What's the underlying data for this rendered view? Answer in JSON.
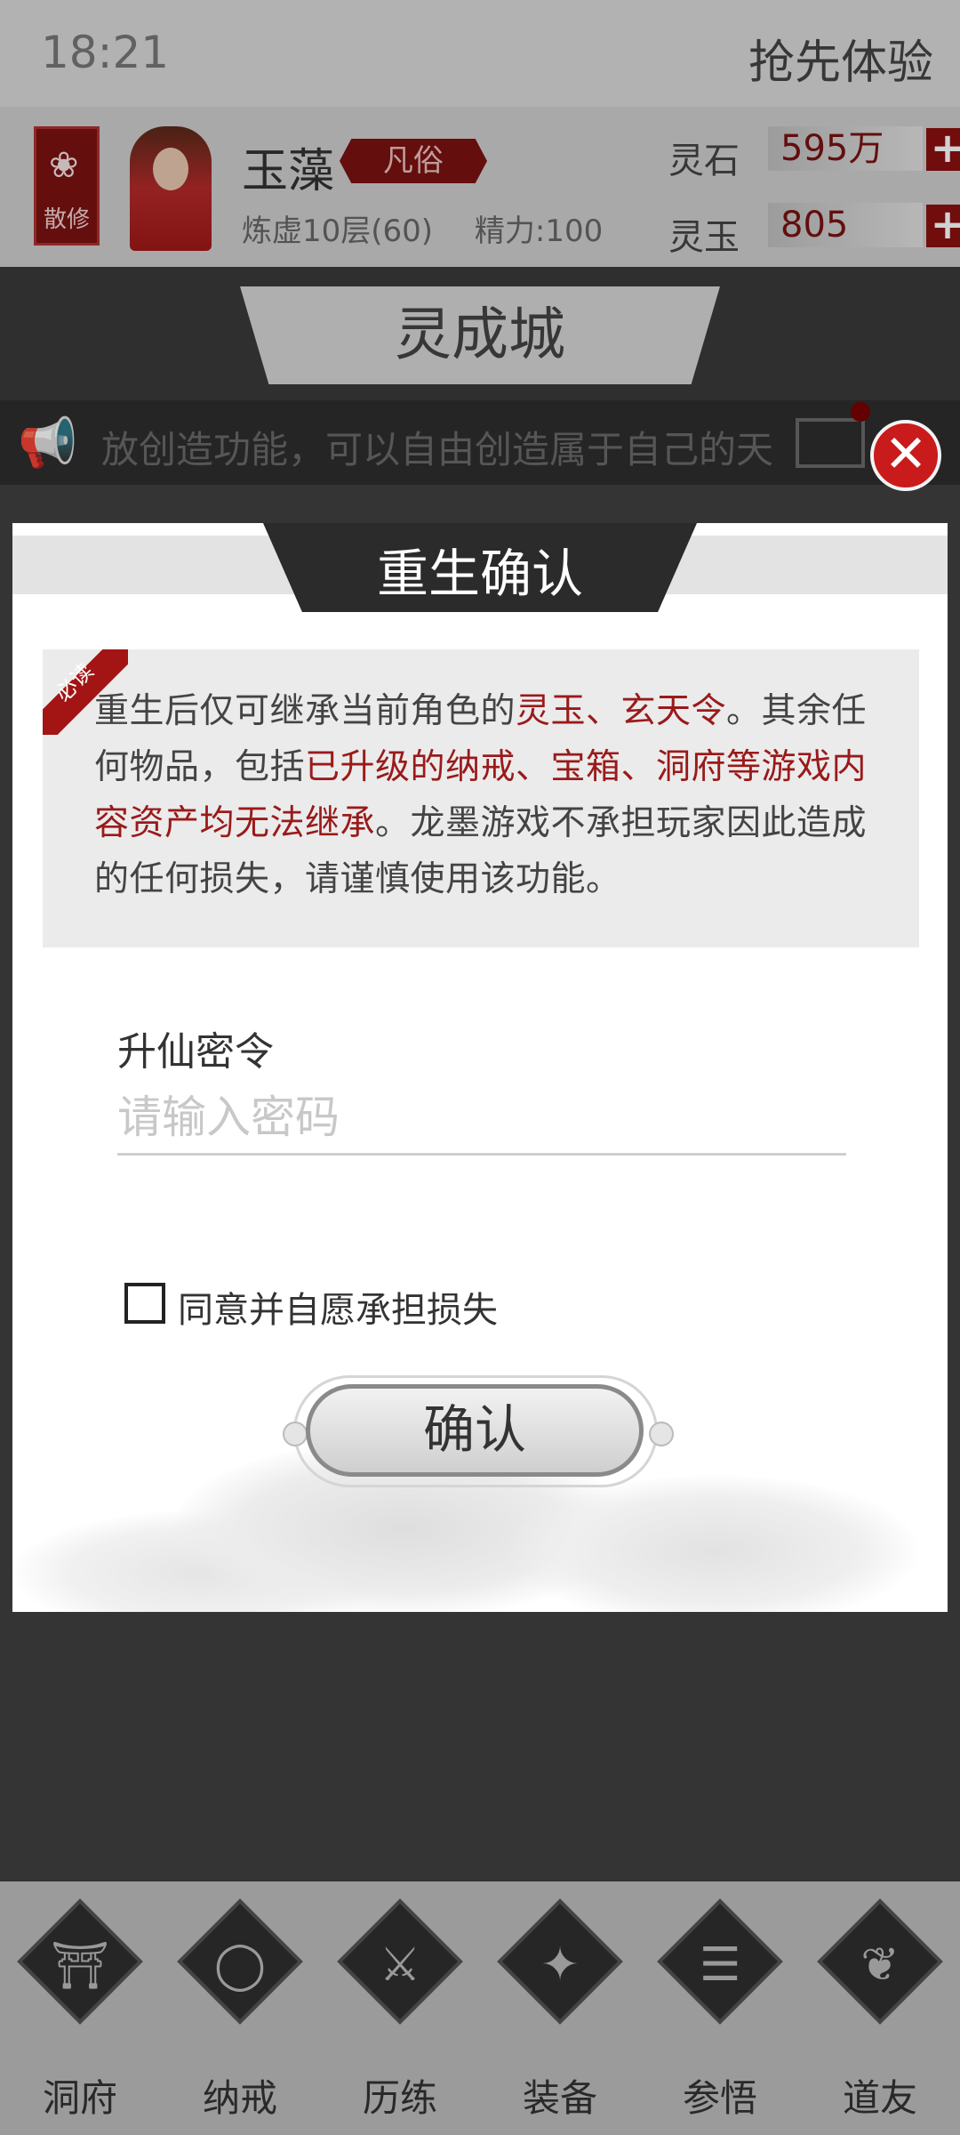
{
  "status_bar": {
    "time": "18:21",
    "early_access": "抢先体验"
  },
  "player": {
    "sect_label": "散修",
    "name": "玉藻",
    "rank": "凡俗",
    "realm": "炼虚10层(60)",
    "energy": "精力:100",
    "currencies": [
      {
        "label": "灵石",
        "value": "595万"
      },
      {
        "label": "灵玉",
        "value": "805"
      }
    ]
  },
  "city": {
    "name": "灵成城"
  },
  "ticker": {
    "text": "放创造功能，可以自由创造属于自己的天"
  },
  "dialog": {
    "title": "重生确认",
    "ribbon": "必读",
    "notice": {
      "p1": "重生后仅可继承当前角色的",
      "h1": "灵玉、玄天令",
      "p2": "。其余任何物品，包括",
      "h2": "已升级的纳戒、宝箱、洞府等游戏内容资产均无法继承",
      "p3": "。龙墨游戏不承担玩家因此造成的任何损失，请谨慎使用该功能。"
    },
    "password_label": "升仙密令",
    "password_placeholder": "请输入密码",
    "agree_text": "同意并自愿承担损失",
    "confirm_label": "确认"
  },
  "bottom_nav": [
    {
      "label": "洞府",
      "icon": "gate-icon",
      "glyph": "⛩"
    },
    {
      "label": "纳戒",
      "icon": "ring-icon",
      "glyph": "◯"
    },
    {
      "label": "历练",
      "icon": "swords-icon",
      "glyph": "⚔"
    },
    {
      "label": "装备",
      "icon": "dagger-icon",
      "glyph": "✦"
    },
    {
      "label": "参悟",
      "icon": "book-icon",
      "glyph": "☰"
    },
    {
      "label": "道友",
      "icon": "handshake-icon",
      "glyph": "❦"
    }
  ],
  "colors": {
    "accent_red": "#9a1a1a",
    "close_red": "#c91b1b",
    "dark": "#2b2b2b"
  }
}
